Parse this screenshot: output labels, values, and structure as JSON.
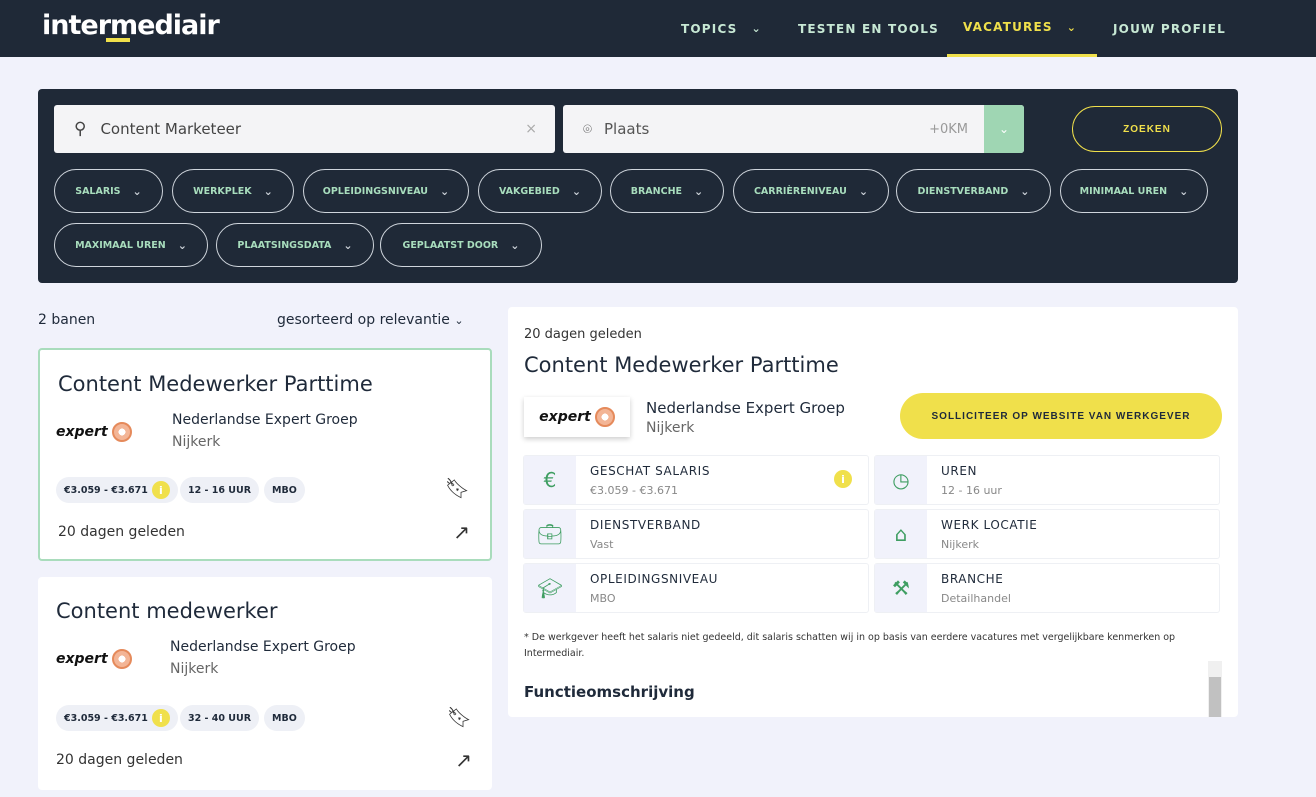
{
  "header": {
    "logo": "intermediair",
    "nav": [
      {
        "label": "TOPICS",
        "chevron": true
      },
      {
        "label": "TESTEN EN TOOLS"
      },
      {
        "label": "VACATURES",
        "chevron": true,
        "active": true
      },
      {
        "label": "JOUW PROFIEL"
      }
    ]
  },
  "search": {
    "query": "Content Marketeer",
    "clear": "×",
    "place_placeholder": "Plaats",
    "radius": "+0KM",
    "submit": "ZOEKEN"
  },
  "filters": [
    "SALARIS",
    "WERKPLEK",
    "OPLEIDINGSNIVEAU",
    "VAKGEBIED",
    "BRANCHE",
    "CARRIÈRENIVEAU",
    "DIENSTVERBAND",
    "MINIMAAL UREN",
    "MAXIMAAL UREN",
    "PLAATSINGSDATA",
    "GEPLAATST DOOR"
  ],
  "results": {
    "count": "2 banen",
    "sort": "gesorteerd op relevantie"
  },
  "jobs": [
    {
      "title": "Content Medewerker Parttime",
      "company": "Nederlandse Expert Groep",
      "logo": "expert",
      "city": "Nijkerk",
      "salary": "€3.059 - €3.671",
      "hours": "12 - 16 UUR",
      "level": "MBO",
      "ago": "20 dagen geleden"
    },
    {
      "title": "Content medewerker",
      "company": "Nederlandse Expert Groep",
      "logo": "expert",
      "city": "Nijkerk",
      "salary": "€3.059 - €3.671",
      "hours": "32 - 40 UUR",
      "level": "MBO",
      "ago": "20 dagen geleden"
    }
  ],
  "detail": {
    "ago": "20 dagen geleden",
    "title": "Content Medewerker Parttime",
    "company": "Nederlandse Expert Groep",
    "logo": "expert",
    "city": "Nijkerk",
    "apply": "SOLLICITEER OP WEBSITE VAN WERKGEVER",
    "facts": [
      {
        "label": "GESCHAT SALARIS",
        "value": "€3.059 - €3.671",
        "icon": "euro-icon"
      },
      {
        "label": "UREN",
        "value": "12 - 16 uur",
        "icon": "clock-icon"
      },
      {
        "label": "DIENSTVERBAND",
        "value": "Vast",
        "icon": "briefcase-icon"
      },
      {
        "label": "WERK LOCATIE",
        "value": "Nijkerk",
        "icon": "building-icon"
      },
      {
        "label": "OPLEIDINGSNIVEAU",
        "value": "MBO",
        "icon": "graduation-icon"
      },
      {
        "label": "BRANCHE",
        "value": "Detailhandel",
        "icon": "tools-icon"
      }
    ],
    "note": "* De werkgever heeft het salaris niet gedeeld, dit salaris schatten wij in op basis van eerdere vacatures met vergelijkbare kenmerken op Intermediair.",
    "section": "Functieomschrijving"
  },
  "colors": {
    "header": "#1f2937",
    "accent_yellow": "#f0e04b",
    "accent_green": "#3f9e62"
  }
}
